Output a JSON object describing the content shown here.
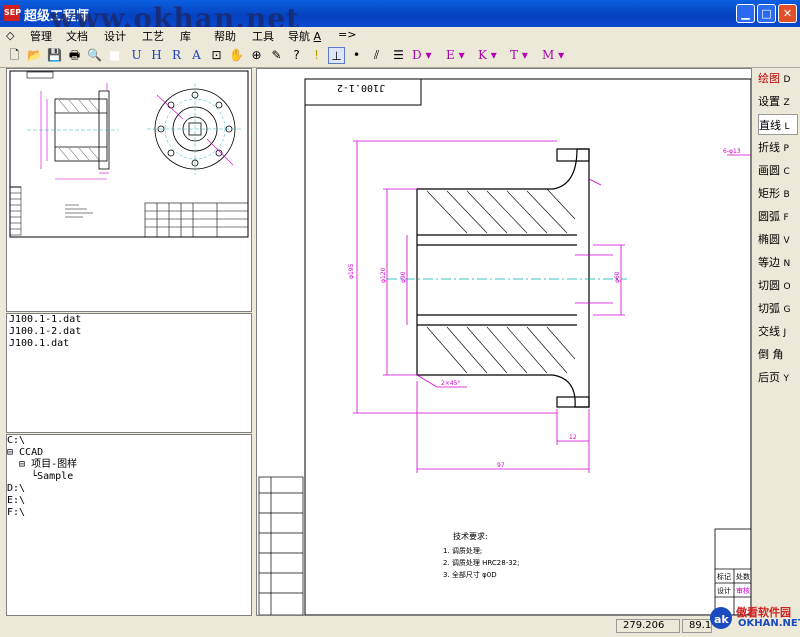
{
  "window": {
    "title": "超级工程师",
    "app_icon": "SEP",
    "watermark": "www.okhan.net"
  },
  "menu": [
    {
      "label": "管理",
      "key": ""
    },
    {
      "label": "文档",
      "key": ""
    },
    {
      "label": "设计",
      "key": ""
    },
    {
      "label": "工艺",
      "key": ""
    },
    {
      "label": "库",
      "key": ""
    },
    {
      "label": "帮助",
      "key": ""
    },
    {
      "label": "工具",
      "key": ""
    },
    {
      "label": "导航",
      "key": "A"
    },
    {
      "label": "=>",
      "key": ""
    }
  ],
  "toolbar_letters": {
    "u": "U",
    "h": "H",
    "r": "R",
    "a": "A",
    "d": "D",
    "e": "E",
    "k": "K",
    "t": "T",
    "m": "M"
  },
  "files": [
    "J100.1-1.dat",
    "J100.1-2.dat",
    "J100.1.dat"
  ],
  "tree": {
    "c": "C:\\",
    "ccad": "⊟ CCAD",
    "project": "  ⊟ 项目-图样",
    "sample": "    └Sample",
    "d": "D:\\",
    "e": "E:\\",
    "f": "F:\\"
  },
  "drawing": {
    "number": "J100.1-2",
    "tech_title": "技术要求:",
    "notes": [
      "1. 调质处理;",
      "2. 调质处理 HRC28-32;",
      "3. 全部尺寸 φ0D"
    ],
    "table": [
      "标记",
      "处数",
      "设计",
      "审核"
    ]
  },
  "right_tools": [
    {
      "label": "绘图",
      "key": "D",
      "active": false
    },
    {
      "label": "设置",
      "key": "Z",
      "active": false
    },
    {
      "label": "直线",
      "key": "L",
      "active": true
    },
    {
      "label": "折线",
      "key": "P",
      "active": false
    },
    {
      "label": "画圆",
      "key": "C",
      "active": false
    },
    {
      "label": "矩形",
      "key": "B",
      "active": false
    },
    {
      "label": "圆弧",
      "key": "F",
      "active": false
    },
    {
      "label": "椭圆",
      "key": "V",
      "active": false
    },
    {
      "label": "等边",
      "key": "N",
      "active": false
    },
    {
      "label": "切圆",
      "key": "O",
      "active": false
    },
    {
      "label": "切弧",
      "key": "G",
      "active": false
    },
    {
      "label": "交线",
      "key": "J",
      "active": false
    },
    {
      "label": "倒 角",
      "key": "",
      "active": false
    },
    {
      "label": "后页",
      "key": "Y",
      "active": false
    }
  ],
  "status": {
    "x": "279.206",
    "y": "89.1"
  },
  "logo": {
    "cn": "傲看软件园",
    "en": "OKHAN.NET"
  },
  "colors": {
    "accent": "#d000d0",
    "title_bar": "#0a5fe0"
  }
}
